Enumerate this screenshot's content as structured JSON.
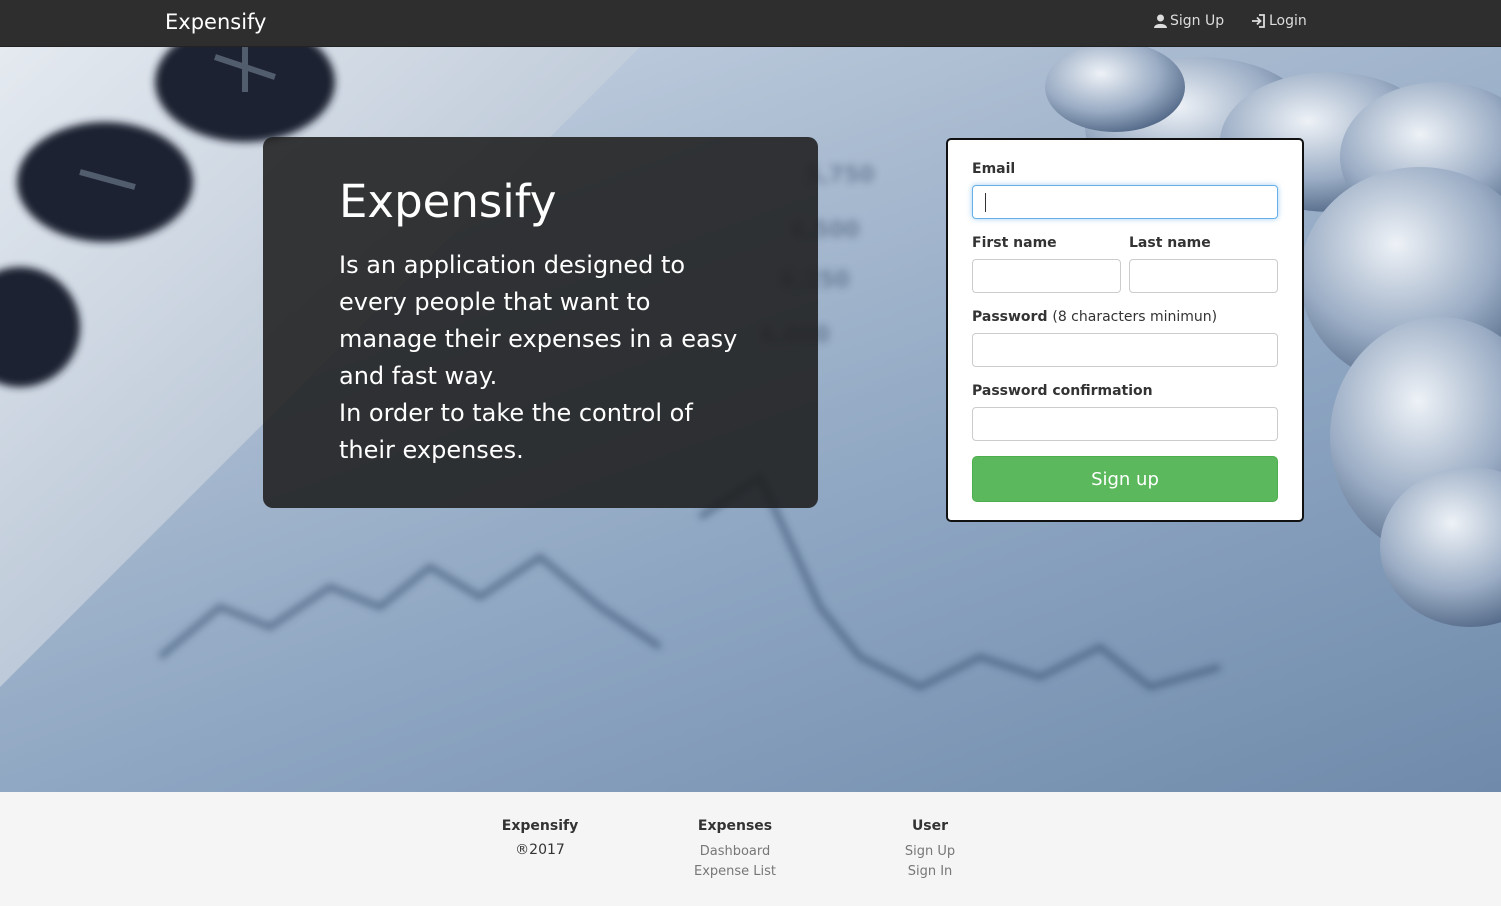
{
  "navbar": {
    "brand": "Expensify",
    "signup_label": "Sign Up",
    "login_label": "Login"
  },
  "hero": {
    "title": "Expensify",
    "description": "Is an application designed to every people that want to manage their expenses in a easy and fast way.",
    "description2": "In order to take the control of their expenses."
  },
  "form": {
    "email_label": "Email",
    "email_value": "",
    "first_name_label": "First name",
    "first_name_value": "",
    "last_name_label": "Last name",
    "last_name_value": "",
    "password_label": "Password",
    "password_hint": "(8 characters minimun)",
    "password_value": "",
    "password_confirmation_label": "Password confirmation",
    "password_confirmation_value": "",
    "submit_label": "Sign up"
  },
  "footer": {
    "col1": {
      "title": "Expensify",
      "text": "®2017"
    },
    "col2": {
      "title": "Expenses",
      "links": [
        "Dashboard",
        "Expense List"
      ]
    },
    "col3": {
      "title": "User",
      "links": [
        "Sign Up",
        "Sign In"
      ]
    }
  },
  "colors": {
    "navbar_bg": "#2e2e2e",
    "primary_button": "#5cb85c",
    "focus_border": "#66afe9"
  },
  "icons": {
    "signup": "user-icon",
    "login": "sign-in-icon"
  }
}
